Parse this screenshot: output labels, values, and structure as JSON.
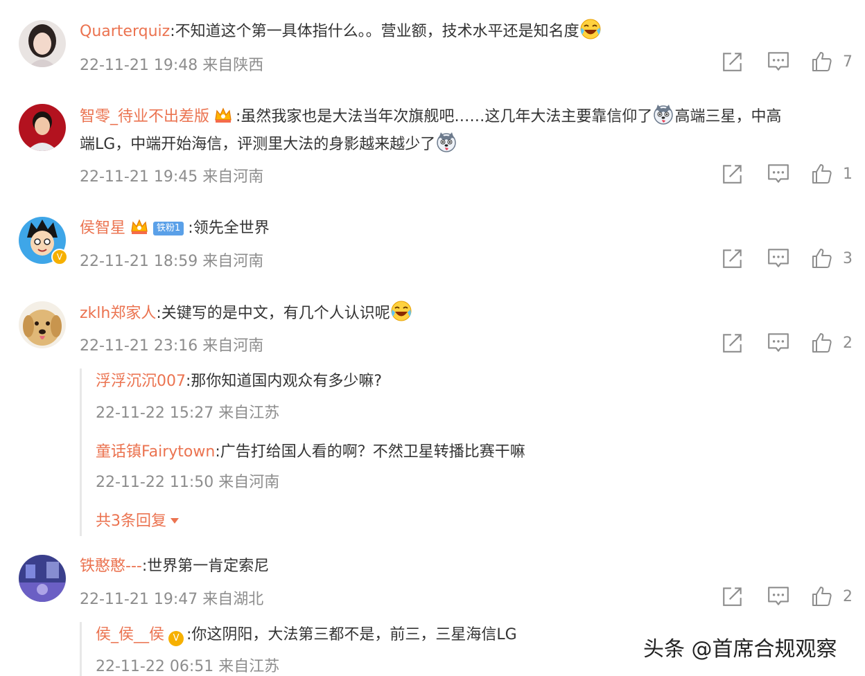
{
  "comments": [
    {
      "user": "Quarterquiz",
      "text": ":不知道这个第一具体指什么。。营业额，技术水平还是知名度",
      "time": "22-11-21 19:48 来自陕西",
      "likes": "7"
    },
    {
      "user": "智零_待业不出差版",
      "text1": ":虽然我家也是大法当年次旗舰吧……这几年大法主要靠信仰了",
      "text2": "高端三星，中高",
      "text3": "端LG，中端开始海信，评测里大法的身影越来越少了",
      "time": "22-11-21 19:45 来自河南",
      "likes": "1"
    },
    {
      "user": "侯智星",
      "fan_badge": "铁粉1",
      "text": ":领先全世界",
      "time": "22-11-21 18:59 来自河南",
      "likes": "3"
    },
    {
      "user": "zklh郑家人",
      "text": ":关键写的是中文，有几个人认识呢",
      "time": "22-11-21 23:16 来自河南",
      "likes": "2",
      "replies": [
        {
          "user": "浮浮沉沉007",
          "text": ":那你知道国内观众有多少嘛?",
          "time": "22-11-22 15:27 来自江苏"
        },
        {
          "user": "童话镇Fairytown",
          "text": ":广告打给国人看的啊？不然卫星转播比赛干嘛",
          "time": "22-11-22 11:50 来自河南"
        }
      ],
      "more_replies": "共3条回复"
    },
    {
      "user": "铁憨憨---",
      "text": ":世界第一肯定索尼",
      "time": "22-11-21 19:47 来自湖北",
      "likes": "2",
      "replies": [
        {
          "user": "侯_侯__侯",
          "text": ":你这阴阳，大法第三都不是，前三，三星海信LG",
          "time": "22-11-22 06:51 来自江苏"
        }
      ]
    }
  ],
  "watermark": "头条 @首席合规观察",
  "colors": {
    "username": "#eb7350",
    "meta": "#8d8d8d",
    "text": "#333333"
  }
}
